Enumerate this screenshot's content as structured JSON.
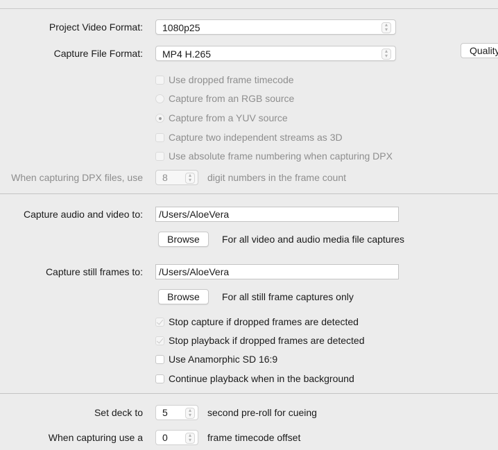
{
  "video": {
    "project_format_label": "Project Video Format:",
    "project_format_value": "1080p25",
    "capture_file_label": "Capture File Format:",
    "capture_file_value": "MP4 H.265",
    "quality_button": "Quality"
  },
  "options": {
    "dropped_tc": "Use dropped frame timecode",
    "rgb_source": "Capture from an RGB source",
    "yuv_source": "Capture from a YUV source",
    "two_streams_3d": "Capture two independent streams as 3D",
    "absolute_numbering": "Use absolute frame numbering when capturing DPX",
    "dpx_label": "When capturing DPX files, use",
    "dpx_digits": "8",
    "dpx_suffix": "digit numbers in the frame count"
  },
  "capture": {
    "av_label": "Capture audio and video to:",
    "av_path": "/Users/AloeVera",
    "av_browse": "Browse",
    "av_hint": "For all video and audio media file captures",
    "still_label": "Capture still frames to:",
    "still_path": "/Users/AloeVera",
    "still_browse": "Browse",
    "still_hint": "For all still frame captures only",
    "stop_capture": "Stop capture if dropped frames are detected",
    "stop_playback": "Stop playback if dropped frames are detected",
    "anamorphic": "Use Anamorphic SD 16:9",
    "continue_playback": "Continue playback when in the background"
  },
  "deck": {
    "set_deck_label": "Set deck to",
    "preroll_value": "5",
    "preroll_suffix": "second pre-roll for cueing",
    "capture_use_label": "When capturing use a",
    "offset_value": "0",
    "offset_suffix": "frame timecode offset"
  }
}
